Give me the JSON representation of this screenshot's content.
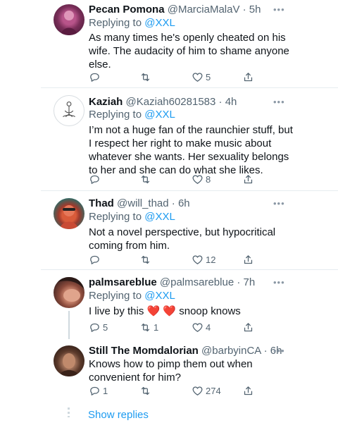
{
  "tweets": [
    {
      "name": "Pecan Pomona",
      "handle": "@MarciaMalaV · 5h",
      "replying_prefix": "Replying to ",
      "replying_to": "@XXL",
      "text": "As many times he's openly cheated on his wife. The audacity of him to shame anyone else.",
      "reply_count": "",
      "retweet_count": "",
      "like_count": "5"
    },
    {
      "name": "Kaziah",
      "handle": "@Kaziah60281583 · 4h",
      "replying_prefix": "Replying to ",
      "replying_to": "@XXL",
      "text": "I’m not a huge fan of the raunchier stuff, but I respect her right to make music about whatever she wants. Her sexuality belongs to her and she can do what she likes.",
      "reply_count": "",
      "retweet_count": "",
      "like_count": "8"
    },
    {
      "name": "Thad",
      "handle": "@will_thad · 6h",
      "replying_prefix": "Replying to ",
      "replying_to": "@XXL",
      "text": "Not a novel perspective, but hypocritical coming from him.",
      "reply_count": "",
      "retweet_count": "",
      "like_count": "12"
    },
    {
      "name": "palmsareblue",
      "handle": "@palmsareblue · 7h",
      "replying_prefix": "Replying to ",
      "replying_to": "@XXL",
      "text_before": "I live by this ",
      "text_emoji": "❤️ ❤️",
      "text_after": " snoop knows",
      "reply_count": "5",
      "retweet_count": "1",
      "like_count": "4"
    },
    {
      "name": "Still The Momdalorian",
      "handle": "@barbyinCA · 6h",
      "text": "Knows how to pimp them out when convenient for him?",
      "reply_count": "1",
      "retweet_count": "",
      "like_count": "274"
    }
  ],
  "more_icon": "•••",
  "show_replies": "Show replies",
  "colors": {
    "link": "#1d9bf0",
    "muted": "#536471",
    "divider": "#e6ecf0"
  }
}
